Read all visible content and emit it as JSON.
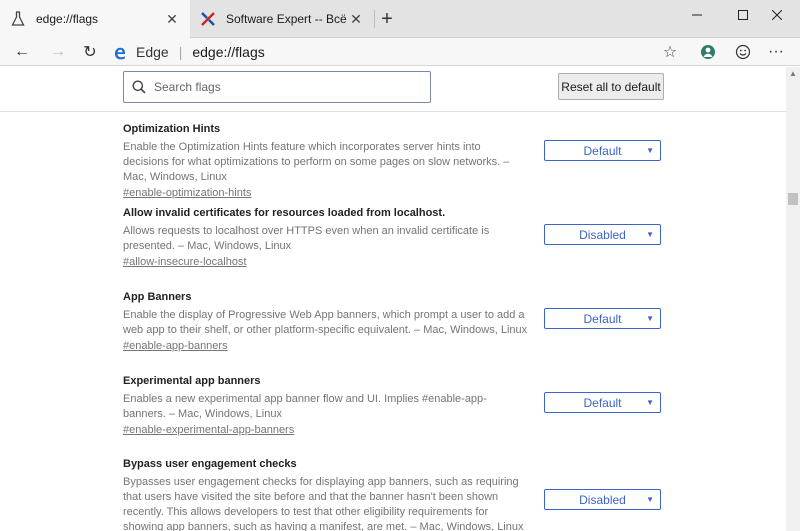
{
  "window": {
    "minimize_glyph": "—",
    "maximize_glyph": "☐",
    "close_glyph": "✕"
  },
  "tabs": [
    {
      "title": "edge://flags",
      "icon": "flask-icon",
      "close_glyph": "✕"
    },
    {
      "title": "Software Expert -- Всё о секрета",
      "icon": "software-expert-favicon",
      "close_glyph": "✕"
    }
  ],
  "new_tab_glyph": "+",
  "toolbar": {
    "back_glyph": "←",
    "forward_glyph": "→",
    "refresh_glyph": "↻",
    "brand": "Edge",
    "separator": "|",
    "url": "edge://flags",
    "star_glyph": "☆",
    "more_glyph": "···"
  },
  "search": {
    "placeholder": "Search flags",
    "value": ""
  },
  "reset_label": "Reset all to default",
  "flags": [
    {
      "name": "Optimization Hints",
      "description": "Enable the Optimization Hints feature which incorporates server hints into decisions for what optimizations to perform on some pages on slow networks. – Mac, Windows, Linux",
      "link": "#enable-optimization-hints",
      "value": "Default"
    },
    {
      "name": "Allow invalid certificates for resources loaded from localhost.",
      "description": "Allows requests to localhost over HTTPS even when an invalid certificate is presented. – Mac, Windows, Linux",
      "link": "#allow-insecure-localhost",
      "value": "Disabled"
    },
    {
      "name": "App Banners",
      "description": "Enable the display of Progressive Web App banners, which prompt a user to add a web app to their shelf, or other platform-specific equivalent. – Mac, Windows, Linux",
      "link": "#enable-app-banners",
      "value": "Default"
    },
    {
      "name": "Experimental app banners",
      "description": "Enables a new experimental app banner flow and UI. Implies #enable-app-banners. – Mac, Windows, Linux",
      "link": "#enable-experimental-app-banners",
      "value": "Default"
    },
    {
      "name": "Bypass user engagement checks",
      "description": "Bypasses user engagement checks for displaying app banners, such as requiring that users have visited the site before and that the banner hasn't been shown recently. This allows developers to test that other eligibility requirements for showing app banners, such as having a manifest, are met. – Mac, Windows, Linux",
      "link": "",
      "value": "Disabled"
    }
  ],
  "select_arrow": "▼",
  "colors": {
    "accent": "#3b63c8",
    "muted_text": "#757575",
    "tabstrip": "#e3e3e3"
  }
}
